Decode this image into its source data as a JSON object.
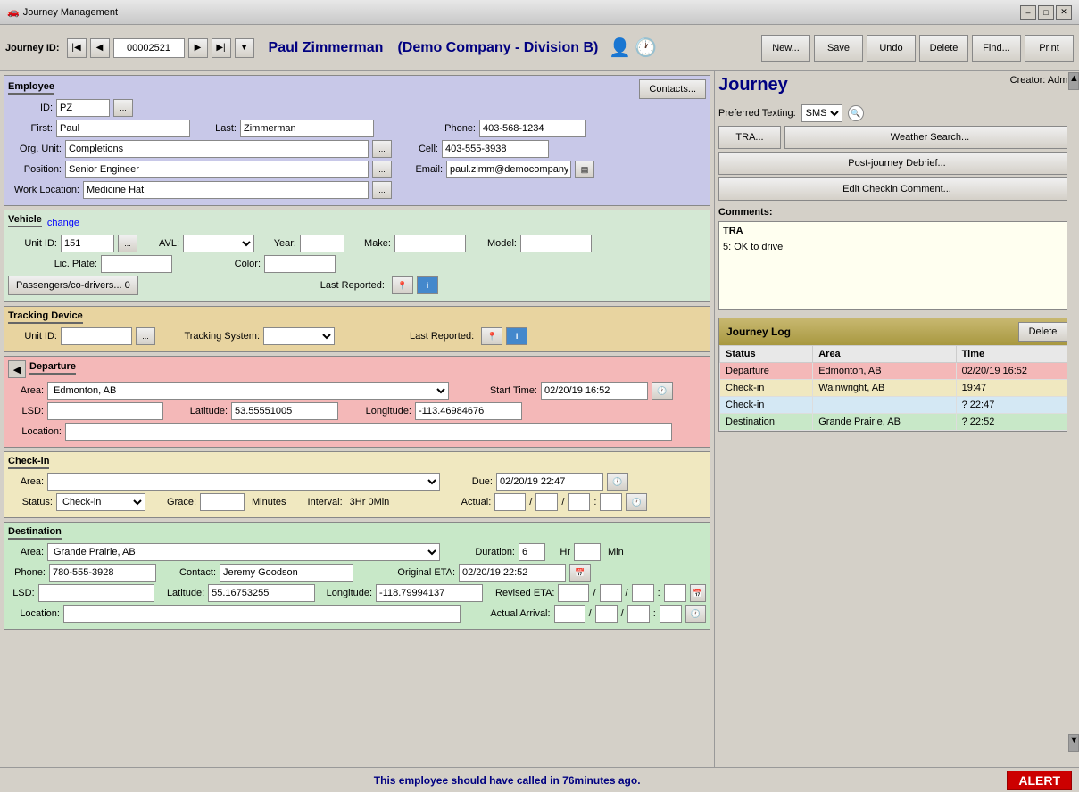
{
  "titleBar": {
    "title": "Journey Management",
    "icon": "🚗",
    "buttons": [
      "–",
      "□",
      "✕"
    ]
  },
  "toolbar": {
    "journeyIdLabel": "Journey ID:",
    "journeyId": "00002521",
    "employeeName": "Paul Zimmerman",
    "companyName": "(Demo Company - Division B)",
    "buttons": {
      "new": "New...",
      "save": "Save",
      "undo": "Undo",
      "delete": "Delete",
      "find": "Find...",
      "print": "Print"
    }
  },
  "employee": {
    "sectionTitle": "Employee",
    "idLabel": "ID:",
    "idValue": "PZ",
    "firstLabel": "First:",
    "firstValue": "Paul",
    "lastLabel": "Last:",
    "lastValue": "Zimmerman",
    "phoneLabel": "Phone:",
    "phoneValue": "403-568-1234",
    "orgUnitLabel": "Org. Unit:",
    "orgUnitValue": "Completions",
    "cellLabel": "Cell:",
    "cellValue": "403-555-3938",
    "positionLabel": "Position:",
    "positionValue": "Senior Engineer",
    "emailLabel": "Email:",
    "emailValue": "paul.zimm@democompany.com",
    "workLocationLabel": "Work Location:",
    "workLocationValue": "Medicine Hat",
    "contactsBtn": "Contacts..."
  },
  "vehicle": {
    "sectionTitle": "Vehicle",
    "changeLabel": "change",
    "unitIdLabel": "Unit ID:",
    "unitIdValue": "151",
    "avlLabel": "AVL:",
    "yearLabel": "Year:",
    "makeLabel": "Make:",
    "modelLabel": "Model:",
    "licPlateLabel": "Lic. Plate:",
    "colorLabel": "Color:",
    "passengersBtn": "Passengers/co-drivers...",
    "passengersCount": "0",
    "lastReportedLabel": "Last Reported:"
  },
  "trackingDevice": {
    "sectionTitle": "Tracking Device",
    "unitIdLabel": "Unit ID:",
    "trackingSystemLabel": "Tracking System:",
    "lastReportedLabel": "Last Reported:"
  },
  "departure": {
    "sectionTitle": "Departure",
    "areaLabel": "Area:",
    "areaValue": "Edmonton, AB",
    "startTimeLabel": "Start Time:",
    "startTimeValue": "02/20/19 16:52",
    "lsdLabel": "LSD:",
    "latitudeLabel": "Latitude:",
    "latitudeValue": "53.55551005",
    "longitudeLabel": "Longitude:",
    "longitudeValue": "-113.46984676",
    "locationLabel": "Location:"
  },
  "checkin": {
    "sectionTitle": "Check-in",
    "areaLabel": "Area:",
    "dueLabel": "Due:",
    "dueValue": "02/20/19 22:47",
    "statusLabel": "Status:",
    "statusValue": "Check-in",
    "graceLabel": "Grace:",
    "minutesLabel": "Minutes",
    "intervalLabel": "Interval:",
    "intervalValue": "3Hr 0Min",
    "actualLabel": "Actual:",
    "actualValue": "/ /"
  },
  "destination": {
    "sectionTitle": "Destination",
    "areaLabel": "Area:",
    "areaValue": "Grande Prairie, AB",
    "durationLabel": "Duration:",
    "durationValue": "6",
    "hrLabel": "Hr",
    "minLabel": "Min",
    "phoneLabel": "Phone:",
    "phoneValue": "780-555-3928",
    "contactLabel": "Contact:",
    "contactValue": "Jeremy Goodson",
    "originalEtaLabel": "Original ETA:",
    "originalEtaValue": "02/20/19 22:52",
    "lsdLabel": "LSD:",
    "latitudeLabel": "Latitude:",
    "latitudeValue": "55.16753255",
    "longitudeLabel": "Longitude:",
    "longitudeValue": "-118.79994137",
    "revisedEtaLabel": "Revised ETA:",
    "revisedEtaValue": "/ /",
    "locationLabel": "Location:",
    "actualArrivalLabel": "Actual Arrival:",
    "actualArrivalValue": "/ /"
  },
  "rightPanel": {
    "journeyTitle": "Journey",
    "creatorLabel": "Creator: Admin",
    "preferredTextingLabel": "Preferred Texting:",
    "preferredTextingValue": "SMS",
    "traBtn": "TRA...",
    "weatherBtn": "Weather Search...",
    "postJourneyBtn": "Post-journey Debrief...",
    "editCheckinBtn": "Edit Checkin Comment...",
    "commentsLabel": "Comments:",
    "commentsTRA": "TRA",
    "commentsText": "5: OK to drive"
  },
  "journeyLog": {
    "title": "Journey Log",
    "deleteBtn": "Delete",
    "columns": [
      "Status",
      "Area",
      "Time"
    ],
    "rows": [
      {
        "status": "Departure",
        "area": "Edmonton, AB",
        "time": "02/20/19 16:52",
        "rowClass": "departure"
      },
      {
        "status": "Check-in",
        "area": "Wainwright, AB",
        "time": "19:47",
        "rowClass": "checkin1"
      },
      {
        "status": "Check-in",
        "area": "",
        "time": "? 22:47",
        "rowClass": "checkin2"
      },
      {
        "status": "Destination",
        "area": "Grande Prairie, AB",
        "time": "? 22:52",
        "rowClass": "destination"
      }
    ]
  },
  "statusBar": {
    "message": "This employee should have called in 76minutes ago.",
    "alertLabel": "ALERT"
  }
}
